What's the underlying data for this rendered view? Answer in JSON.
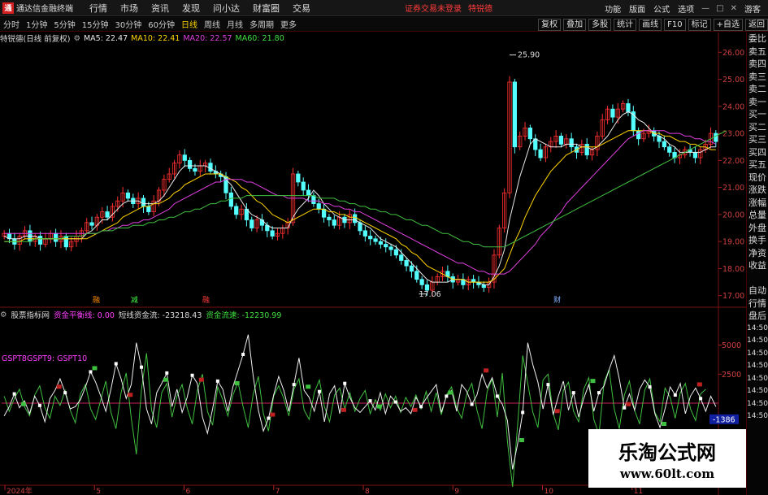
{
  "menubar": {
    "logo_glyph": "通",
    "app_title": "通达信金融终端",
    "items": [
      "行情",
      "市场",
      "资讯",
      "发现",
      "问小达",
      "财富圈",
      "交易"
    ],
    "login_warning": "证券交易未登录",
    "login_user": "特锐德",
    "right_items": [
      "功能",
      "版面",
      "公式",
      "选项"
    ],
    "guest": "游客"
  },
  "toolbar": {
    "periods": [
      "分时",
      "1分钟",
      "5分钟",
      "15分钟",
      "30分钟",
      "60分钟",
      "日线",
      "周线",
      "月线",
      "多周期",
      "更多"
    ],
    "active_period": "日线",
    "right_buttons": [
      "复权",
      "叠加",
      "多股",
      "统计",
      "画线",
      "F10",
      "标记",
      "+自选",
      "返回"
    ]
  },
  "sidebar": {
    "items": [
      "委比",
      "卖五",
      "卖四",
      "卖三",
      "卖二",
      "卖一",
      "买一",
      "买二",
      "买三",
      "买四",
      "买五",
      "现价",
      "涨跌",
      "涨幅",
      "总量",
      "外盘",
      "换手",
      "净资",
      "收益",
      "",
      "自动",
      "行情",
      "盘后",
      "14:50",
      "14:50",
      "14:50",
      "14:50",
      "14:50",
      "14:50",
      "14:50",
      "14:50"
    ]
  },
  "price_info": {
    "title": "特锐德(日线 前复权)",
    "ma5": "MA5: 22.47",
    "ma10": "MA10: 22.41",
    "ma20": "MA20: 22.57",
    "ma60": "MA60: 21.80"
  },
  "indicator_info": {
    "name": "股票指标网",
    "balance": "资金平衡线: 0.00",
    "short_flow": "短线资金流: -23218.43",
    "fund_flow": "资金流速: -12230.99",
    "gsp": "GSPT8GSPT9: GSPT10"
  },
  "chart_data": [
    {
      "type": "candlestick",
      "y_ticks": [
        "26.00",
        "25.00",
        "24.00",
        "23.00",
        "22.00",
        "21.00",
        "20.00",
        "19.00",
        "18.00",
        "17.00"
      ],
      "ylim": [
        16.75,
        26.25
      ],
      "high_label": "25.90",
      "low_label": "17.06",
      "markers": [
        {
          "text": "融",
          "x_frac": 0.127,
          "color": "#ff8c00"
        },
        {
          "text": "减",
          "x_frac": 0.18,
          "color": "#40ff40"
        },
        {
          "text": "融",
          "x_frac": 0.28,
          "color": "#ff3b3b"
        },
        {
          "text": "财",
          "x_frac": 0.77,
          "color": "#80b0ff"
        }
      ],
      "closes": [
        19.3,
        19.1,
        18.9,
        19.2,
        19.4,
        19.0,
        19.2,
        18.9,
        19.1,
        19.3,
        19.0,
        19.2,
        18.8,
        19.0,
        19.2,
        19.4,
        19.7,
        19.6,
        19.9,
        20.1,
        19.9,
        20.3,
        20.5,
        20.8,
        20.6,
        20.4,
        20.6,
        20.3,
        20.1,
        20.5,
        20.9,
        21.3,
        21.5,
        21.9,
        22.2,
        22.0,
        21.7,
        21.6,
        21.8,
        21.9,
        21.6,
        21.5,
        21.4,
        20.8,
        20.3,
        20.0,
        20.2,
        19.8,
        19.5,
        19.8,
        19.6,
        19.4,
        19.2,
        19.3,
        19.5,
        19.7,
        21.5,
        21.2,
        20.9,
        20.7,
        20.4,
        20.2,
        19.9,
        19.8,
        19.6,
        19.9,
        19.7,
        20.0,
        19.7,
        19.4,
        19.2,
        19.1,
        19.0,
        18.9,
        18.8,
        18.7,
        18.5,
        18.3,
        18.1,
        17.9,
        17.6,
        17.4,
        17.2,
        17.5,
        17.7,
        17.9,
        17.7,
        17.5,
        17.6,
        17.4,
        17.6,
        17.5,
        17.4,
        17.3,
        17.5,
        18.5,
        19.5,
        20.8,
        24.9,
        22.5,
        22.9,
        23.2,
        22.8,
        22.4,
        22.1,
        22.5,
        22.7,
        22.9,
        22.6,
        22.8,
        22.5,
        22.3,
        22.6,
        22.2,
        22.4,
        22.9,
        23.5,
        23.9,
        23.6,
        23.9,
        24.1,
        23.8,
        23.1,
        22.8,
        23.0,
        23.1,
        22.9,
        22.7,
        22.5,
        22.3,
        22.1,
        22.2,
        22.4,
        22.3,
        22.1,
        22.4,
        22.6,
        23.0,
        22.7
      ],
      "ma_short": [
        19.2,
        19.1,
        19.1,
        19.1,
        19.2,
        19.2,
        19.2,
        19.1,
        19.1,
        19.1,
        19.1,
        19.1,
        19.1,
        19.1,
        19.1,
        19.1,
        19.3,
        19.4,
        19.6,
        19.8,
        19.8,
        20.0,
        20.2,
        20.4,
        20.5,
        20.5,
        20.5,
        20.4,
        20.4,
        20.4,
        20.5,
        20.7,
        21.0,
        21.3,
        21.6,
        21.8,
        21.8,
        21.8,
        21.8,
        21.8,
        21.7,
        21.6,
        21.5,
        21.3,
        21.1,
        20.8,
        20.5,
        20.2,
        20.0,
        19.9,
        19.8,
        19.6,
        19.5,
        19.5,
        19.5,
        19.5,
        19.9,
        20.2,
        20.4,
        20.6,
        20.9,
        20.7,
        20.4,
        20.2,
        20.0,
        19.9,
        19.8,
        19.8,
        19.8,
        19.7,
        19.6,
        19.5,
        19.3,
        19.1,
        19.0,
        18.9,
        18.8,
        18.6,
        18.4,
        18.2,
        18.0,
        17.8,
        17.6,
        17.5,
        17.5,
        17.5,
        17.5,
        17.6,
        17.6,
        17.6,
        17.5,
        17.5,
        17.5,
        17.4,
        17.4,
        17.7,
        18.1,
        18.7,
        19.8,
        20.6,
        21.4,
        22.0,
        22.6,
        22.8,
        22.7,
        22.6,
        22.5,
        22.5,
        22.5,
        22.6,
        22.6,
        22.6,
        22.5,
        22.5,
        22.4,
        22.5,
        22.7,
        22.9,
        23.2,
        23.5,
        23.7,
        23.8,
        23.7,
        23.5,
        23.4,
        23.2,
        23.0,
        22.9,
        22.8,
        22.6,
        22.5,
        22.3,
        22.3,
        22.3,
        22.3,
        22.3,
        22.4,
        22.5,
        22.5
      ],
      "ma_mid": [
        19.0,
        19.0,
        19.0,
        19.0,
        19.1,
        19.1,
        19.1,
        19.1,
        19.1,
        19.1,
        19.1,
        19.1,
        19.1,
        19.1,
        19.1,
        19.1,
        19.1,
        19.2,
        19.3,
        19.4,
        19.5,
        19.6,
        19.7,
        19.9,
        20.0,
        20.1,
        20.2,
        20.3,
        20.3,
        20.4,
        20.4,
        20.5,
        20.6,
        20.8,
        20.9,
        21.1,
        21.2,
        21.3,
        21.4,
        21.5,
        21.5,
        21.5,
        21.5,
        21.4,
        21.3,
        21.2,
        21.0,
        20.9,
        20.7,
        20.5,
        20.4,
        20.2,
        20.0,
        19.9,
        19.8,
        19.7,
        19.8,
        19.9,
        20.0,
        20.1,
        20.2,
        20.2,
        20.2,
        20.1,
        20.1,
        20.0,
        20.0,
        19.9,
        19.9,
        19.8,
        19.7,
        19.6,
        19.5,
        19.4,
        19.3,
        19.2,
        19.1,
        18.9,
        18.8,
        18.6,
        18.5,
        18.3,
        18.1,
        18.0,
        17.9,
        17.8,
        17.7,
        17.6,
        17.6,
        17.6,
        17.5,
        17.5,
        17.5,
        17.5,
        17.5,
        17.6,
        17.8,
        18.0,
        18.5,
        19.0,
        19.4,
        19.9,
        20.3,
        20.7,
        21.0,
        21.3,
        21.6,
        21.8,
        22.0,
        22.2,
        22.3,
        22.4,
        22.5,
        22.5,
        22.5,
        22.5,
        22.6,
        22.7,
        22.8,
        22.9,
        23.0,
        23.1,
        23.1,
        23.1,
        23.1,
        23.1,
        23.0,
        23.0,
        22.9,
        22.9,
        22.8,
        22.7,
        22.7,
        22.6,
        22.6,
        22.5,
        22.5,
        22.4,
        22.4
      ],
      "ma20": [
        19.3,
        19.3,
        19.3,
        19.3,
        19.3,
        19.3,
        19.3,
        19.3,
        19.3,
        19.3,
        19.3,
        19.3,
        19.3,
        19.3,
        19.3,
        19.3,
        19.3,
        19.3,
        19.3,
        19.4,
        19.4,
        19.5,
        19.5,
        19.6,
        19.6,
        19.7,
        19.7,
        19.8,
        19.8,
        19.9,
        20.0,
        20.1,
        20.2,
        20.4,
        20.5,
        20.6,
        20.7,
        20.8,
        20.9,
        21.0,
        21.1,
        21.2,
        21.2,
        21.3,
        21.3,
        21.3,
        21.3,
        21.2,
        21.2,
        21.1,
        21.0,
        20.9,
        20.8,
        20.7,
        20.7,
        20.6,
        20.6,
        20.6,
        20.6,
        20.5,
        20.5,
        20.5,
        20.4,
        20.4,
        20.3,
        20.3,
        20.2,
        20.2,
        20.1,
        20.1,
        20.0,
        19.9,
        19.8,
        19.7,
        19.6,
        19.5,
        19.4,
        19.3,
        19.2,
        19.1,
        19.0,
        18.9,
        18.8,
        18.7,
        18.6,
        18.5,
        18.4,
        18.3,
        18.2,
        18.2,
        18.1,
        18.0,
        17.9,
        17.9,
        17.8,
        17.8,
        17.8,
        17.8,
        17.9,
        18.1,
        18.3,
        18.5,
        18.7,
        18.9,
        19.2,
        19.4,
        19.6,
        19.9,
        20.1,
        20.4,
        20.6,
        20.8,
        21.0,
        21.2,
        21.4,
        21.6,
        21.8,
        22.0,
        22.2,
        22.4,
        22.6,
        22.8,
        22.9,
        23.0,
        23.1,
        23.1,
        23.1,
        23.1,
        23.1,
        23.0,
        23.0,
        23.0,
        22.9,
        22.9,
        22.8,
        22.8,
        22.7,
        22.7,
        22.6
      ],
      "ma60": [
        19.0,
        19.0,
        19.0,
        19.0,
        19.0,
        19.0,
        19.1,
        19.1,
        19.1,
        19.1,
        19.1,
        19.1,
        19.2,
        19.2,
        19.2,
        19.2,
        19.3,
        19.3,
        19.3,
        19.4,
        19.4,
        19.4,
        19.5,
        19.5,
        19.5,
        19.6,
        19.6,
        19.6,
        19.7,
        19.7,
        19.8,
        19.8,
        19.9,
        19.9,
        20.0,
        20.1,
        20.1,
        20.2,
        20.2,
        20.3,
        20.4,
        20.4,
        20.5,
        20.5,
        20.6,
        20.6,
        20.6,
        20.7,
        20.7,
        20.7,
        20.7,
        20.7,
        20.7,
        20.7,
        20.7,
        20.7,
        20.7,
        20.7,
        20.7,
        20.7,
        20.7,
        20.6,
        20.6,
        20.6,
        20.6,
        20.5,
        20.5,
        20.4,
        20.4,
        20.3,
        20.3,
        20.2,
        20.2,
        20.1,
        20.1,
        20.0,
        20.0,
        19.9,
        19.8,
        19.8,
        19.7,
        19.6,
        19.6,
        19.5,
        19.4,
        19.3,
        19.3,
        19.2,
        19.1,
        19.0,
        19.0,
        18.9,
        18.9,
        18.8,
        18.8,
        18.8,
        18.8,
        18.8,
        18.9,
        19.0,
        19.1,
        19.2,
        19.3,
        19.4,
        19.5,
        19.6,
        19.7,
        19.8,
        19.9,
        20.0,
        20.1,
        20.2,
        20.3,
        20.4,
        20.5,
        20.6,
        20.7,
        20.8,
        20.9,
        21.0,
        21.1,
        21.2,
        21.3,
        21.4,
        21.5,
        21.6,
        21.7,
        21.8,
        21.9,
        22.0,
        22.1,
        22.2,
        22.3,
        22.4,
        22.5,
        22.6,
        22.7,
        22.8,
        22.9,
        23.0,
        23.1
      ]
    },
    {
      "type": "line",
      "y_ticks": [
        "5000",
        "2500",
        "-1386",
        "-2500"
      ],
      "ylim": [
        -7000,
        7000
      ],
      "current_value": "-1386",
      "x_labels": [
        "2024年",
        "5",
        "6",
        "7",
        "8",
        "9",
        "10",
        "11"
      ],
      "white_line": [
        -1100,
        -300,
        800,
        -400,
        200,
        -900,
        600,
        -200,
        -1600,
        400,
        1100,
        2100,
        900,
        -500,
        -300,
        300,
        1400,
        2700,
        1800,
        600,
        -700,
        1200,
        3400,
        2100,
        400,
        1600,
        5200,
        3100,
        -500,
        -1800,
        900,
        1700,
        2600,
        -300,
        1200,
        -800,
        500,
        2400,
        1700,
        -1200,
        -2600,
        -500,
        1900,
        1200,
        -700,
        1400,
        2800,
        4200,
        5900,
        2300,
        -600,
        -2400,
        -1300,
        700,
        2300,
        1100,
        -700,
        1600,
        3900,
        1100,
        500,
        -700,
        1000,
        -1600,
        800,
        1500,
        -900,
        1700,
        500,
        -400,
        -800,
        -300,
        200,
        -600,
        900,
        -900,
        600,
        100,
        -700,
        -400,
        -900,
        500,
        -300,
        400,
        1000,
        1600,
        -800,
        600,
        1100,
        -700,
        1600,
        1000,
        -100,
        700,
        2500,
        1300,
        2200,
        600,
        -100,
        -1500,
        -5700,
        -3500,
        -800,
        5200,
        3300,
        1800,
        -500,
        1600,
        -1000,
        600,
        1900,
        -600,
        900,
        -1200,
        400,
        1600,
        -700,
        900,
        1500,
        2900,
        4100,
        2100,
        -400,
        800,
        -600,
        1200,
        2000,
        1400,
        -900,
        -2100,
        -500,
        1400,
        700,
        1700,
        -900,
        600,
        1300,
        400,
        -700,
        600,
        -300
      ],
      "green_line": [
        600,
        -700,
        400,
        1200,
        -300,
        -1100,
        700,
        1500,
        -400,
        -1300,
        600,
        -200,
        1100,
        -600,
        -1700,
        800,
        1600,
        -500,
        -1400,
        300,
        1900,
        -800,
        -2200,
        900,
        2600,
        -1300,
        -4400,
        1100,
        4300,
        -600,
        -2100,
        900,
        1700,
        -1200,
        600,
        1600,
        -400,
        -1800,
        1100,
        2500,
        -700,
        -1900,
        1400,
        300,
        -1100,
        700,
        1800,
        -300,
        -2100,
        800,
        2300,
        -900,
        -2400,
        600,
        1500,
        400,
        -1100,
        1200,
        2100,
        -600,
        -1400,
        900,
        2000,
        -300,
        -1600,
        700,
        1300,
        -500,
        900,
        -700,
        400,
        1100,
        -900,
        300,
        -600,
        800,
        -400,
        600,
        -800,
        500,
        -300,
        700,
        -500,
        1000,
        -700,
        900,
        -1000,
        700,
        1400,
        -400,
        -1300,
        800,
        1700,
        -600,
        -2200,
        1000,
        2100,
        -1200,
        2600,
        -3300,
        -7200,
        -1900,
        4100,
        1700,
        -800,
        -2100,
        2000,
        2500,
        -900,
        -2300,
        1100,
        1800,
        -700,
        -1600,
        1200,
        2200,
        -1400,
        -2700,
        1800,
        2900,
        -500,
        -2200,
        700,
        1900,
        -600,
        -1800,
        1100,
        2100,
        -800,
        -1600,
        1300,
        500,
        -1300,
        900,
        1700,
        -500,
        -1500,
        800,
        1200
      ]
    }
  ],
  "watermark": {
    "title": "乐淘公式网",
    "url": "www.60lt.com"
  }
}
